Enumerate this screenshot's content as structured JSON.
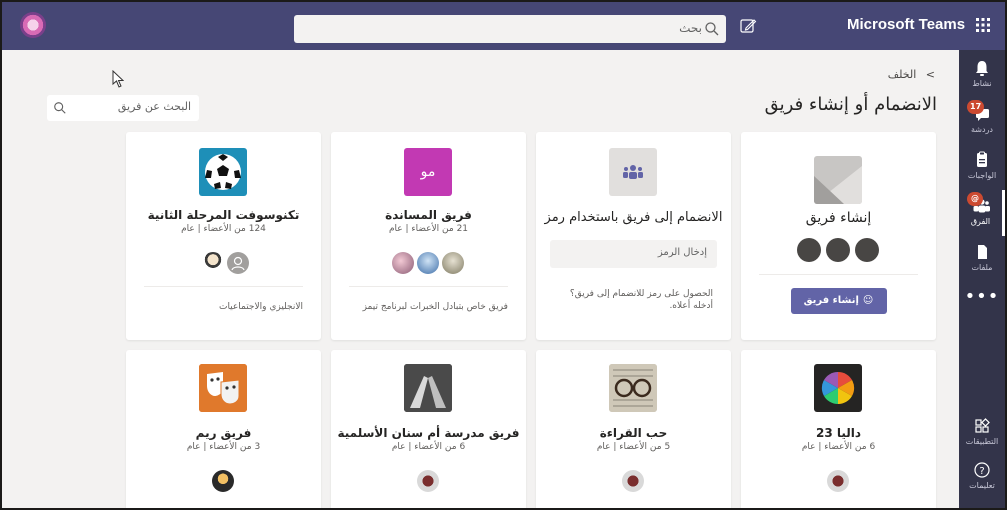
{
  "app": {
    "brand": "Microsoft Teams",
    "accent": "#464775",
    "rail_color": "#33344a",
    "primary_button": "#6264a7"
  },
  "topbar": {
    "search_placeholder": "بحث",
    "compose_icon": "compose-icon",
    "apps_icon": "waffle-icon"
  },
  "rail": {
    "items": [
      {
        "label": "نشاط",
        "icon": "bell-icon"
      },
      {
        "label": "دردشة",
        "icon": "chat-icon",
        "badge": "17"
      },
      {
        "label": "الواجبات",
        "icon": "assignments-icon"
      },
      {
        "label": "الفرق",
        "icon": "teams-icon",
        "badge": "@",
        "active": true
      },
      {
        "label": "ملفات",
        "icon": "files-icon"
      }
    ],
    "more": "•••",
    "bottom": [
      {
        "label": "التطبيقات",
        "icon": "apps-icon"
      },
      {
        "label": "تعليمات",
        "icon": "help-icon"
      }
    ]
  },
  "main": {
    "back": "الخلف",
    "title": "الانضمام أو إنشاء فريق",
    "team_search_placeholder": "البحث عن فريق"
  },
  "cards_row1": {
    "create": {
      "title": "إنشاء فريق",
      "button": "إنشاء فريق"
    },
    "join": {
      "title": "الانضمام إلى فريق باستخدام رمز",
      "input_placeholder": "إدخال الرمز",
      "hint": "الحصول على رمز للانضمام إلى فريق؟ أدخله أعلاه."
    },
    "support": {
      "title": "فريق المساندة",
      "meta": "21 من الأعضاء | عام",
      "logo_text": "مو",
      "logo_color": "#c239b3",
      "desc": "فريق خاص بتبادل الخبرات لبرنامج تيمز"
    },
    "techno": {
      "title": "تكنوسوفت المرحلة الثانية",
      "meta": "124 من الأعضاء | عام",
      "desc": "الانجليزي والاجتماعيات"
    }
  },
  "cards_row2": {
    "dalia": {
      "title": "داليا 23",
      "meta": "6 من الأعضاء | عام"
    },
    "reading": {
      "title": "حب القراءة",
      "meta": "5 من الأعضاء | عام"
    },
    "school": {
      "title": "فريق مدرسة أم سنان الأسلمية",
      "meta": "6 من الأعضاء | عام"
    },
    "reem": {
      "title": "فريق ريم",
      "meta": "3 من الأعضاء | عام"
    }
  }
}
